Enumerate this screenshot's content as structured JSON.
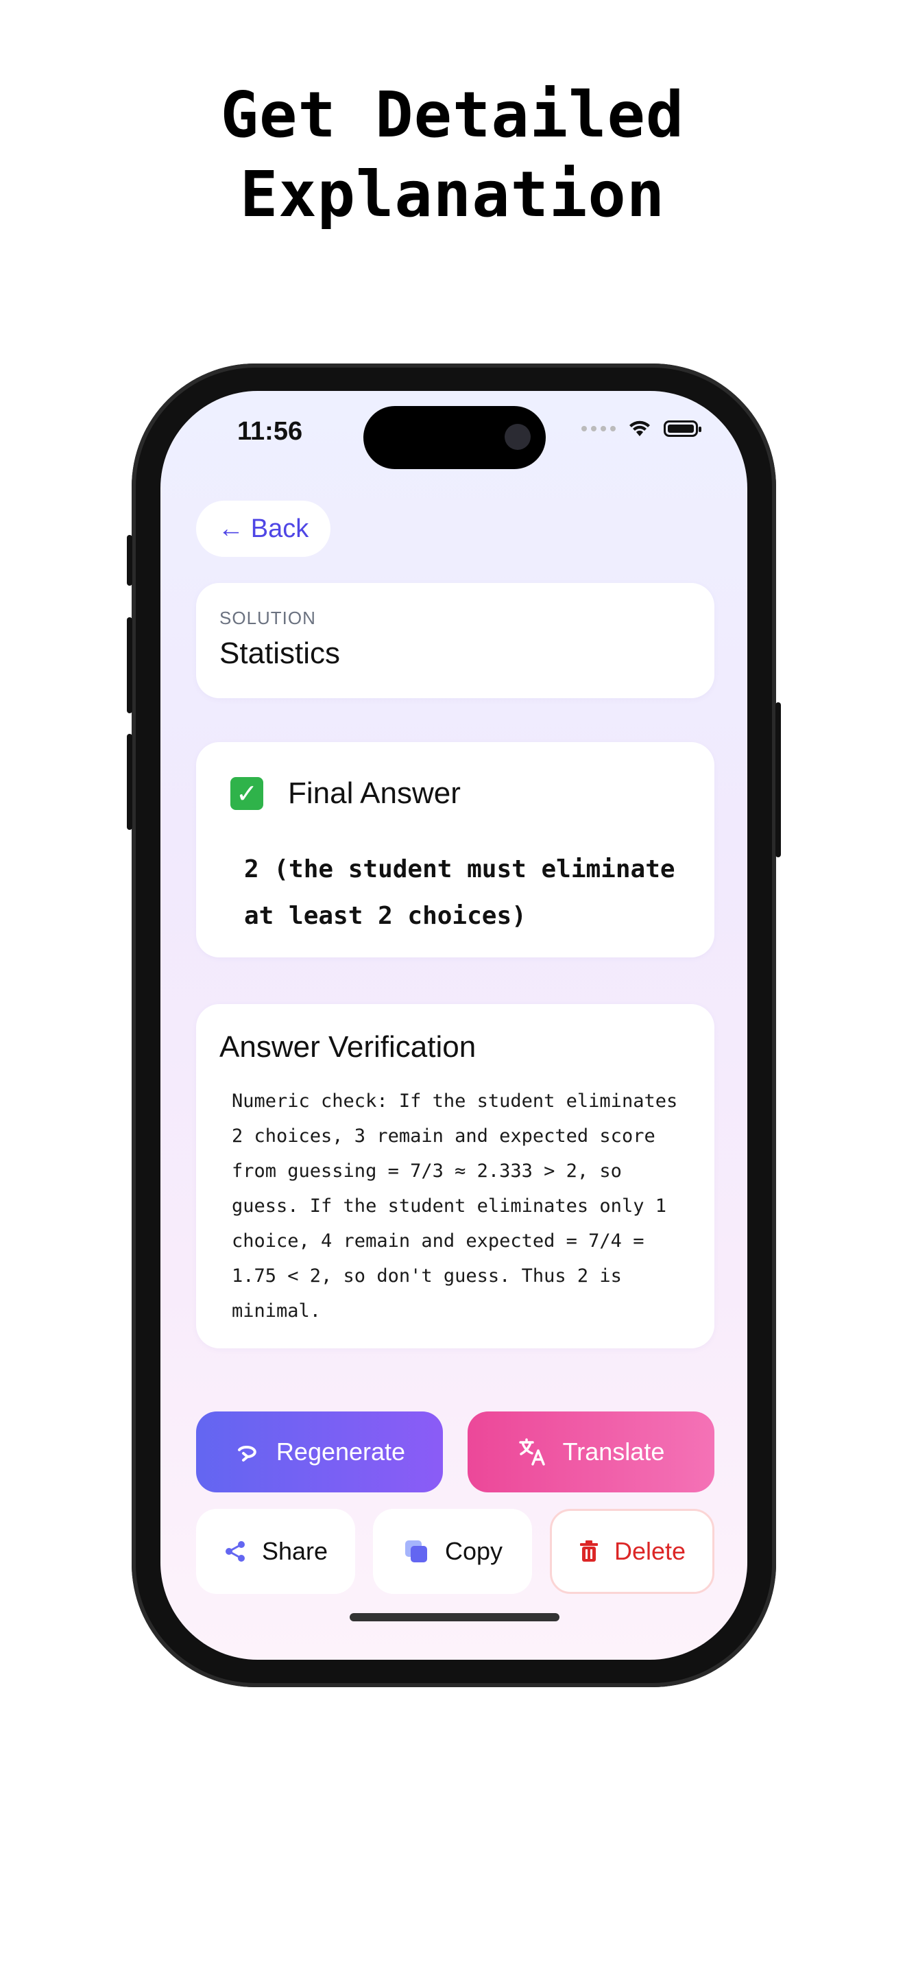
{
  "promo": {
    "headline_line1": "Get Detailed",
    "headline_line2": "Explanation"
  },
  "status_bar": {
    "time": "11:56"
  },
  "nav": {
    "back_label": "Back",
    "back_arrow": "←"
  },
  "solution_card": {
    "label": "SOLUTION",
    "title": "Statistics"
  },
  "final_answer": {
    "icon": "check-mark-icon",
    "title": "Final Answer",
    "body": "2 (the student must eliminate at least 2 choices)"
  },
  "verification": {
    "title": "Answer Verification",
    "body": "Numeric check: If the student eliminates 2 choices, 3 remain and expected score from guessing = 7/3 ≈ 2.333 > 2, so guess. If the student eliminates only 1 choice, 4 remain and expected = 7/4 = 1.75 < 2, so don't guess. Thus 2 is minimal."
  },
  "actions": {
    "regenerate_label": "Regenerate",
    "translate_label": "Translate",
    "share_label": "Share",
    "copy_label": "Copy",
    "delete_label": "Delete"
  },
  "colors": {
    "accent": "#4f46e5",
    "regenerate_gradient": [
      "#6366f1",
      "#8b5cf6"
    ],
    "translate_gradient": [
      "#ec4899",
      "#f472b6"
    ],
    "delete": "#dc2626",
    "check_green": "#2fb34a"
  }
}
